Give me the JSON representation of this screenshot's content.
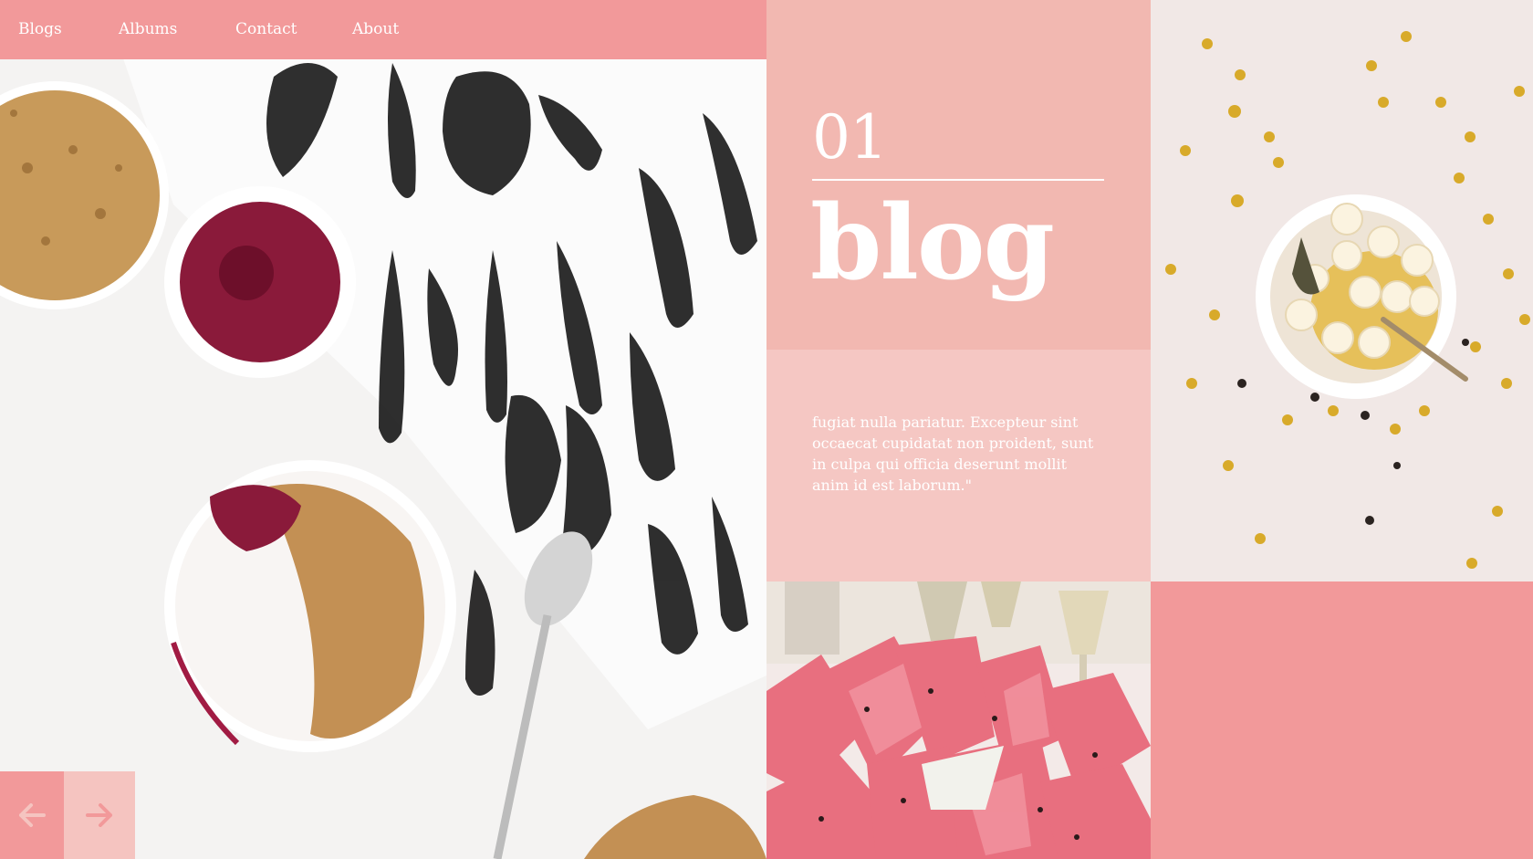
{
  "nav": {
    "items": [
      "Blogs",
      "Albums",
      "Contact",
      "About"
    ]
  },
  "hero": {
    "lettering": "YOUR MIND ONCE DA",
    "prev_icon": "arrow-left-icon",
    "next_icon": "arrow-right-icon"
  },
  "post": {
    "number": "01",
    "title": "blog",
    "excerpt": "fugiat nulla pariatur. Excepteur sint occaecat cupidatat non proident, sunt in culpa qui officia deserunt mollit anim id est laborum.\""
  },
  "colors": {
    "nav_bg": "#f2999a",
    "title_panel": "#f2b8b1",
    "excerpt_panel": "#f5c7c3",
    "pink_block": "#f2999a",
    "text": "#ffffff"
  }
}
